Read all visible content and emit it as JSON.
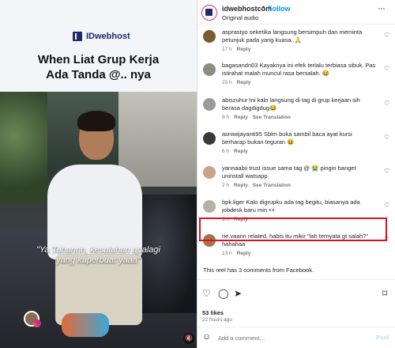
{
  "reel": {
    "brand": "IDwebhost",
    "headline_line1": "When Liat Grup Kerja",
    "headline_line2": "Ada Tanda @.. nya",
    "caption_line1": "\"Ya Tuhannn, kesalahan apalagi",
    "caption_line2": "yang kuperbuat yaaa\""
  },
  "header": {
    "username": "idwebhostcom",
    "dot": "•",
    "follow": "Follow",
    "audio": "Original audio",
    "more": "···"
  },
  "comments": [
    {
      "user": "asprastyo",
      "text": "seketika langsung bersimpuh dan meminta petunjuk pada yang kuasa..🙏",
      "time": "17 h",
      "reply": "Reply",
      "translate": "",
      "avatar_color": "#7a5c2e"
    },
    {
      "user": "bagasandri03",
      "text": "Kayaknya ini efek terlalu terbiasa sibuk. Pas istirahat malah muncul rasa bersalah. 😂",
      "time": "20 h",
      "reply": "Reply",
      "translate": "",
      "avatar_color": "#8c8f7d"
    },
    {
      "user": "abiszuhur",
      "text": "Ini kalo langsung di tag di grup kerjaan sih berasa dagdigdug😂",
      "time": "9 h",
      "reply": "Reply",
      "translate": "See Translation",
      "avatar_color": "#9a9a9a"
    },
    {
      "user": "asniwijayanti95",
      "text": "Sblm buka sambil baca ayat kursi berharap bukan teguran 😆",
      "time": "6 h",
      "reply": "Reply",
      "translate": "",
      "avatar_color": "#3a3a3a"
    },
    {
      "user": "yannaabii",
      "text": "trust issue sama tag @ 😭 pingin banget uninstall watsapp",
      "time": "2 h",
      "reply": "Reply",
      "translate": "See Translation",
      "avatar_color": "#c9a38a"
    },
    {
      "user": "bpk.liger",
      "text": "Kalo digrupku ada tag begitu, biasanya ada jobdesk baru min 👀",
      "time": "3 h",
      "reply": "Reply",
      "translate": "",
      "avatar_color": "#b8b0a6"
    },
    {
      "user": "rie.vaann",
      "text": "related, habis itu mikir \"lah ternyata gt salah?\" hahahaa",
      "time": "13 h",
      "reply": "Reply",
      "translate": "",
      "avatar_color": "#a5724f"
    }
  ],
  "facebook_note": "This reel has 3 comments from Facebook.",
  "actions": {
    "like_icon": "heart-icon",
    "comment_icon": "comment-icon",
    "share_icon": "share-icon",
    "save_icon": "bookmark-icon",
    "likes": "53 likes",
    "ago": "22 hours ago"
  },
  "add_comment": {
    "placeholder": "Add a comment…",
    "post": "Post"
  }
}
